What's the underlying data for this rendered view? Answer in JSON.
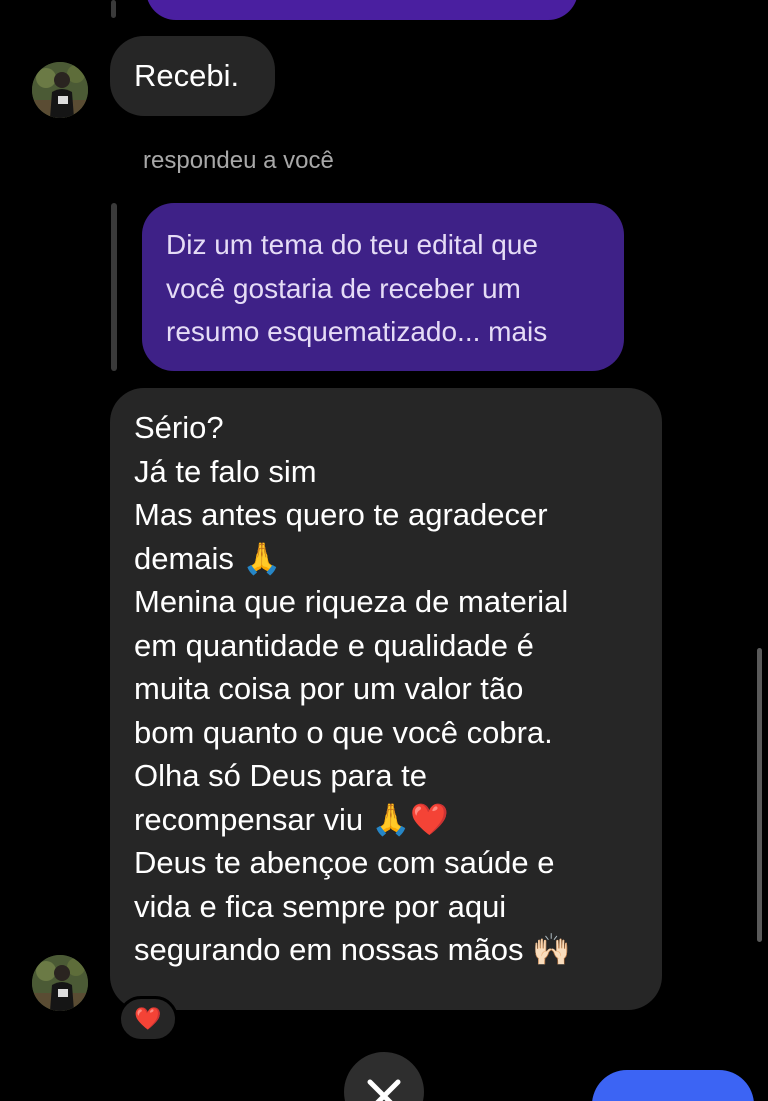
{
  "conversation": {
    "previous_reply_label": "respondeu a você",
    "messages": {
      "recebi": "Recebi.",
      "quoted_reply": {
        "lines": [
          "Diz um tema do teu edital que",
          "você gostaria de receber um",
          "resumo esquematizado... mais"
        ]
      },
      "main": {
        "lines": [
          "Sério?",
          "Já te falo sim",
          "Mas antes quero te agradecer",
          "demais 🙏",
          "Menina que riqueza de material",
          "em quantidade e qualidade é",
          "muita coisa por um valor tão",
          "bom quanto o que você cobra.",
          "Olha só Deus para te",
          "recompensar viu 🙏❤️",
          "Deus te abençoe com saúde e",
          "vida e fica sempre por aqui",
          "segurando em nossas mãos 🙌🏻"
        ],
        "reaction": "❤️"
      }
    }
  },
  "colors": {
    "background": "#000000",
    "incoming_bubble": "#262626",
    "outgoing_bubble": "#4a1fa0",
    "quoted_bubble": "#3e2187",
    "send_button": "#3c64f4"
  },
  "icons": {
    "avatar": "profile-photo",
    "close": "close-icon"
  }
}
